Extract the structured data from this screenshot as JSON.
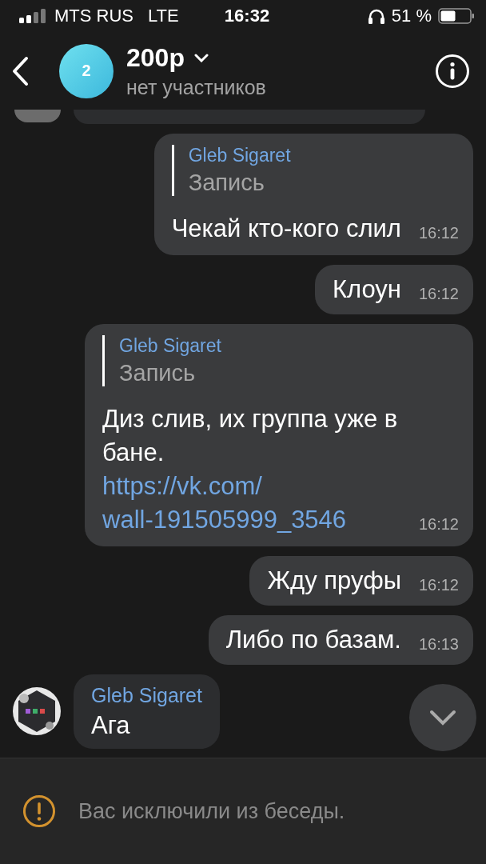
{
  "status_bar": {
    "carrier": "MTS RUS",
    "network": "LTE",
    "time": "16:32",
    "battery": "51 %"
  },
  "header": {
    "avatar_text": "2",
    "title": "200р",
    "subtitle": "нет участников"
  },
  "messages": [
    {
      "kind": "partial",
      "outgoing": false
    },
    {
      "kind": "reply",
      "outgoing": true,
      "quote_author": "Gleb Sigaret",
      "quote_text": "Запись",
      "text": "Чекай кто-кого слил",
      "time": "16:12"
    },
    {
      "kind": "text",
      "outgoing": true,
      "text": "Клоун",
      "time": "16:12"
    },
    {
      "kind": "reply",
      "outgoing": true,
      "quote_author": "Gleb Sigaret",
      "quote_text": "Запись",
      "text": "Диз слив, их группа уже в бане.",
      "link": "https://vk.com/wall-191505999_3546",
      "time": "16:12"
    },
    {
      "kind": "text",
      "outgoing": true,
      "text": "Жду пруфы",
      "time": "16:12"
    },
    {
      "kind": "text",
      "outgoing": true,
      "text": "Либо по базам.",
      "time": "16:13"
    },
    {
      "kind": "named",
      "outgoing": false,
      "author": "Gleb Sigaret",
      "text": "Ага"
    }
  ],
  "notice": {
    "text": "Вас исключили из беседы."
  }
}
